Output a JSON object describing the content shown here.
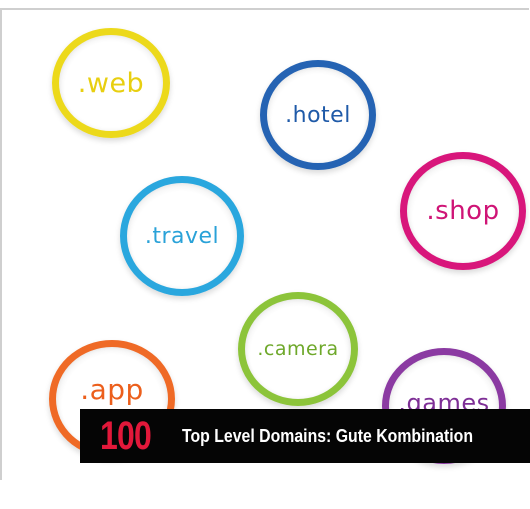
{
  "domains": [
    {
      "label": ".web",
      "color": "#ecd91b",
      "text_color": "#e8cf10"
    },
    {
      "label": ".hotel",
      "color": "#2563b3",
      "text_color": "#1f5aa8"
    },
    {
      "label": ".shop",
      "color": "#d8167b",
      "text_color": "#cf1476"
    },
    {
      "label": ".travel",
      "color": "#2aa7de",
      "text_color": "#2aa2d8"
    },
    {
      "label": ".camera",
      "color": "#8cc43a",
      "text_color": "#6ea82a"
    },
    {
      "label": ".app",
      "color": "#ef6a26",
      "text_color": "#ec5f1c"
    },
    {
      "label": ".games",
      "color": "#8b3aa2",
      "text_color": "#7e2f96"
    }
  ],
  "banner": {
    "number": "100",
    "caption": "Top Level Domains: Gute Kombination",
    "number_color": "#e2183a",
    "background": "#050505"
  }
}
